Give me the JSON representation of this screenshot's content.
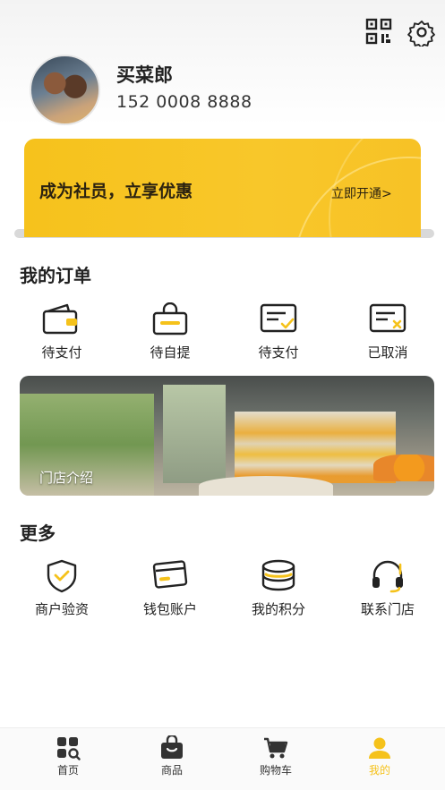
{
  "header": {
    "qr_icon": "qr-code-icon",
    "settings_icon": "gear-icon"
  },
  "profile": {
    "name": "买菜郎",
    "phone": "152 0008 8888"
  },
  "member_banner": {
    "title": "成为社员，立享优惠",
    "action": "立即开通>"
  },
  "orders": {
    "title": "我的订单",
    "items": [
      {
        "label": "待支付",
        "icon": "wallet-icon"
      },
      {
        "label": "待自提",
        "icon": "shopping-bag-icon"
      },
      {
        "label": "待支付",
        "icon": "receipt-check-icon"
      },
      {
        "label": "已取消",
        "icon": "receipt-cancel-icon"
      }
    ]
  },
  "store": {
    "label": "门店介绍"
  },
  "more": {
    "title": "更多",
    "items": [
      {
        "label": "商户验资",
        "icon": "shield-check-icon"
      },
      {
        "label": "钱包账户",
        "icon": "card-icon"
      },
      {
        "label": "我的积分",
        "icon": "coins-icon"
      },
      {
        "label": "联系门店",
        "icon": "headset-icon"
      }
    ]
  },
  "tabbar": {
    "active": "我的",
    "items": [
      {
        "label": "首页",
        "icon": "home-grid-icon"
      },
      {
        "label": "商品",
        "icon": "goods-bag-icon"
      },
      {
        "label": "购物车",
        "icon": "cart-icon"
      },
      {
        "label": "我的",
        "icon": "user-icon"
      }
    ]
  },
  "colors": {
    "accent": "#f5c21b",
    "text": "#222222"
  }
}
